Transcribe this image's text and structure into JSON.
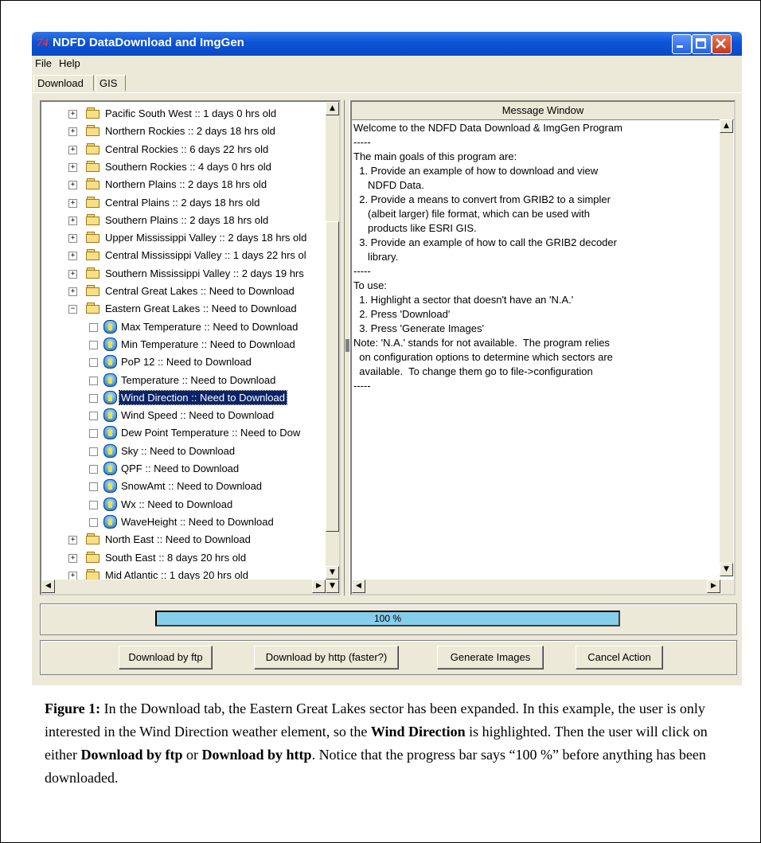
{
  "window": {
    "title": "NDFD DataDownload and ImgGen",
    "icon_glyph": "74"
  },
  "menu": {
    "file": "File",
    "help": "Help"
  },
  "tabs": [
    {
      "label": "Download"
    },
    {
      "label": "GIS"
    }
  ],
  "tree": {
    "items": [
      {
        "label": "Pacific South West :: 1 days 0 hrs old",
        "kind": "folder",
        "state": "+"
      },
      {
        "label": "Northern Rockies :: 2 days 18 hrs old",
        "kind": "folder",
        "state": "+"
      },
      {
        "label": "Central Rockies :: 6 days 22 hrs old",
        "kind": "folder",
        "state": "+"
      },
      {
        "label": "Southern Rockies :: 4 days 0 hrs old",
        "kind": "folder",
        "state": "+"
      },
      {
        "label": "Northern Plains :: 2 days 18 hrs old",
        "kind": "folder",
        "state": "+"
      },
      {
        "label": "Central Plains :: 2 days 18 hrs old",
        "kind": "folder",
        "state": "+"
      },
      {
        "label": "Southern Plains :: 2 days 18 hrs old",
        "kind": "folder",
        "state": "+"
      },
      {
        "label": "Upper Mississippi Valley :: 2 days 18 hrs old",
        "kind": "folder",
        "state": "+"
      },
      {
        "label": "Central Mississippi Valley :: 1 days 22 hrs ol",
        "kind": "folder",
        "state": "+"
      },
      {
        "label": "Southern Mississippi Valley :: 2 days 19 hrs",
        "kind": "folder",
        "state": "+"
      },
      {
        "label": "Central Great Lakes :: Need to Download",
        "kind": "folder",
        "state": "+"
      },
      {
        "label": "Eastern Great Lakes :: Need to Download",
        "kind": "folder",
        "state": "−"
      },
      {
        "label": "Max Temperature :: Need to Download",
        "kind": "element"
      },
      {
        "label": "Min Temperature :: Need to Download",
        "kind": "element"
      },
      {
        "label": "PoP 12 :: Need to Download",
        "kind": "element"
      },
      {
        "label": "Temperature :: Need to Download",
        "kind": "element"
      },
      {
        "label": "Wind Direction :: Need to Download",
        "kind": "element",
        "selected": true
      },
      {
        "label": "Wind Speed :: Need to Download",
        "kind": "element"
      },
      {
        "label": "Dew Point Temperature :: Need to Dow",
        "kind": "element"
      },
      {
        "label": "Sky :: Need to Download",
        "kind": "element"
      },
      {
        "label": "QPF :: Need to Download",
        "kind": "element"
      },
      {
        "label": "SnowAmt :: Need to Download",
        "kind": "element"
      },
      {
        "label": "Wx :: Need to Download",
        "kind": "element"
      },
      {
        "label": "WaveHeight :: Need to Download",
        "kind": "element"
      },
      {
        "label": "North East :: Need to Download",
        "kind": "folder",
        "state": "+"
      },
      {
        "label": "South East :: 8 days 20 hrs old",
        "kind": "folder",
        "state": "+"
      },
      {
        "label": "Mid Atlantic :: 1 days 20 hrs old",
        "kind": "folder",
        "state": "+"
      }
    ]
  },
  "message_window": {
    "header": "Message Window",
    "lines": [
      "Welcome to the NDFD Data Download & ImgGen Program",
      "-----",
      "The main goals of this program are:",
      "  1. Provide an example of how to download and view",
      "     NDFD Data.",
      "  2. Provide a means to convert from GRIB2 to a simpler",
      "     (albeit larger) file format, which can be used with",
      "     products like ESRI GIS.",
      "  3. Provide an example of how to call the GRIB2 decoder",
      "     library.",
      "-----",
      "To use:",
      "  1. Highlight a sector that doesn't have an 'N.A.'",
      "  2. Press 'Download'",
      "  3. Press 'Generate Images'",
      "Note: 'N.A.' stands for not available.  The program relies",
      "  on configuration options to determine which sectors are",
      "  available.  To change them go to file->configuration",
      "-----"
    ]
  },
  "progress": {
    "text": "100 %",
    "value": 1.0
  },
  "buttons": {
    "ftp": "Download by ftp",
    "http": "Download by http (faster?)",
    "generate": "Generate Images",
    "cancel": "Cancel Action"
  },
  "caption": {
    "label": "Figure 1:",
    "t1": "  In the Download tab, the Eastern Great Lakes sector has been expanded.  In this example, the user is only interested in the Wind Direction weather element, so the ",
    "b1": "Wind Direction",
    "t2": " is highlighted. Then the user will click on either ",
    "b2": "Download by ftp",
    "t3": " or ",
    "b3": "Download by http",
    "t4": ". Notice that the progress bar says “100 %” before anything has been downloaded."
  },
  "colors": {
    "titlebar": "#0c53d6",
    "selection": "#0a246a",
    "progress": "#87ceeb"
  }
}
